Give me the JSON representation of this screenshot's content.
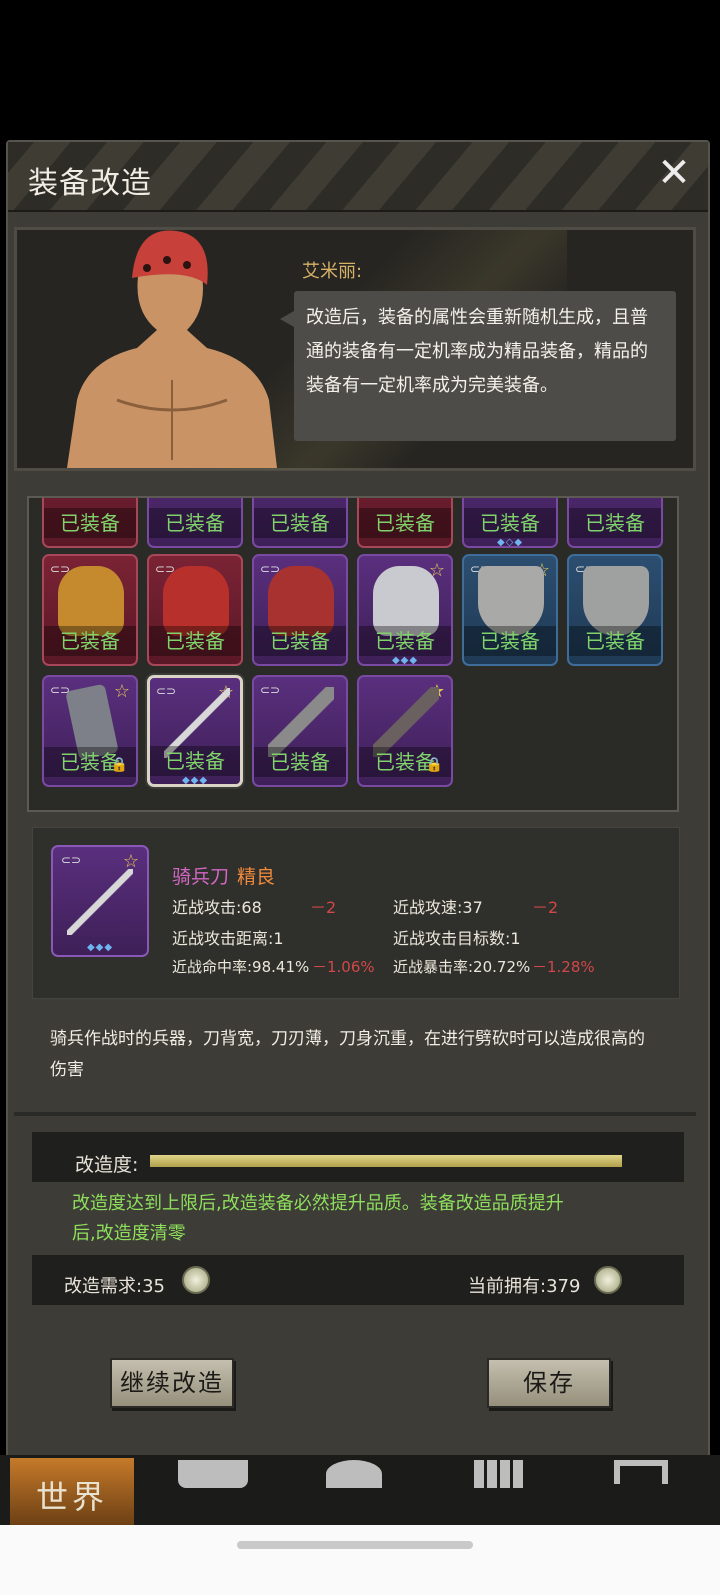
{
  "dialog": {
    "title": "装备改造",
    "close_label": "✕"
  },
  "npc": {
    "name": "艾米丽:",
    "speech": "改造后，装备的属性会重新随机生成，且普通的装备有一定机率成为精品装备，精品的装备有一定机率成为完美装备。"
  },
  "grid": {
    "equipped_label": "已装备",
    "rows": [
      [
        "已装备",
        "已装备",
        "已装备",
        "已装备",
        "已装备",
        "已装备"
      ],
      [
        "已装备",
        "已装备",
        "已装备",
        "已装备",
        "已装备",
        "已装备"
      ],
      [
        "已装备",
        "已装备",
        "已装备",
        "已装备"
      ]
    ]
  },
  "selected": {
    "name": "骑兵刀",
    "quality": "精良",
    "stats": {
      "atk": "近战攻击:68",
      "atk_delta": "－2",
      "speed": "近战攻速:37",
      "speed_delta": "－2",
      "range": "近战攻击距离:1",
      "targets": "近战攻击目标数:1",
      "hit": "近战命中率:98.41%",
      "hit_delta": "－1.06%",
      "crit": "近战暴击率:20.72%",
      "crit_delta": "－1.28%"
    },
    "description": "骑兵作战时的兵器，刀背宽，刀刃薄，刀身沉重，在进行劈砍时可以造成很高的伤害"
  },
  "progress": {
    "label": "改造度:",
    "fill_fraction": 1.0,
    "note": "改造度达到上限后,改造装备必然提升品质。装备改造品质提升后,改造度清零"
  },
  "cost": {
    "required": "改造需求:35",
    "owned": "当前拥有:379"
  },
  "buttons": {
    "continue": "继续改造",
    "save": "保存"
  },
  "nav": {
    "world": "世界"
  },
  "colors": {
    "equipped_text": "#7fd36a",
    "name": "#d267c4",
    "quality": "#f08a3c",
    "negative": "#d04848",
    "note": "#8ee05c"
  }
}
